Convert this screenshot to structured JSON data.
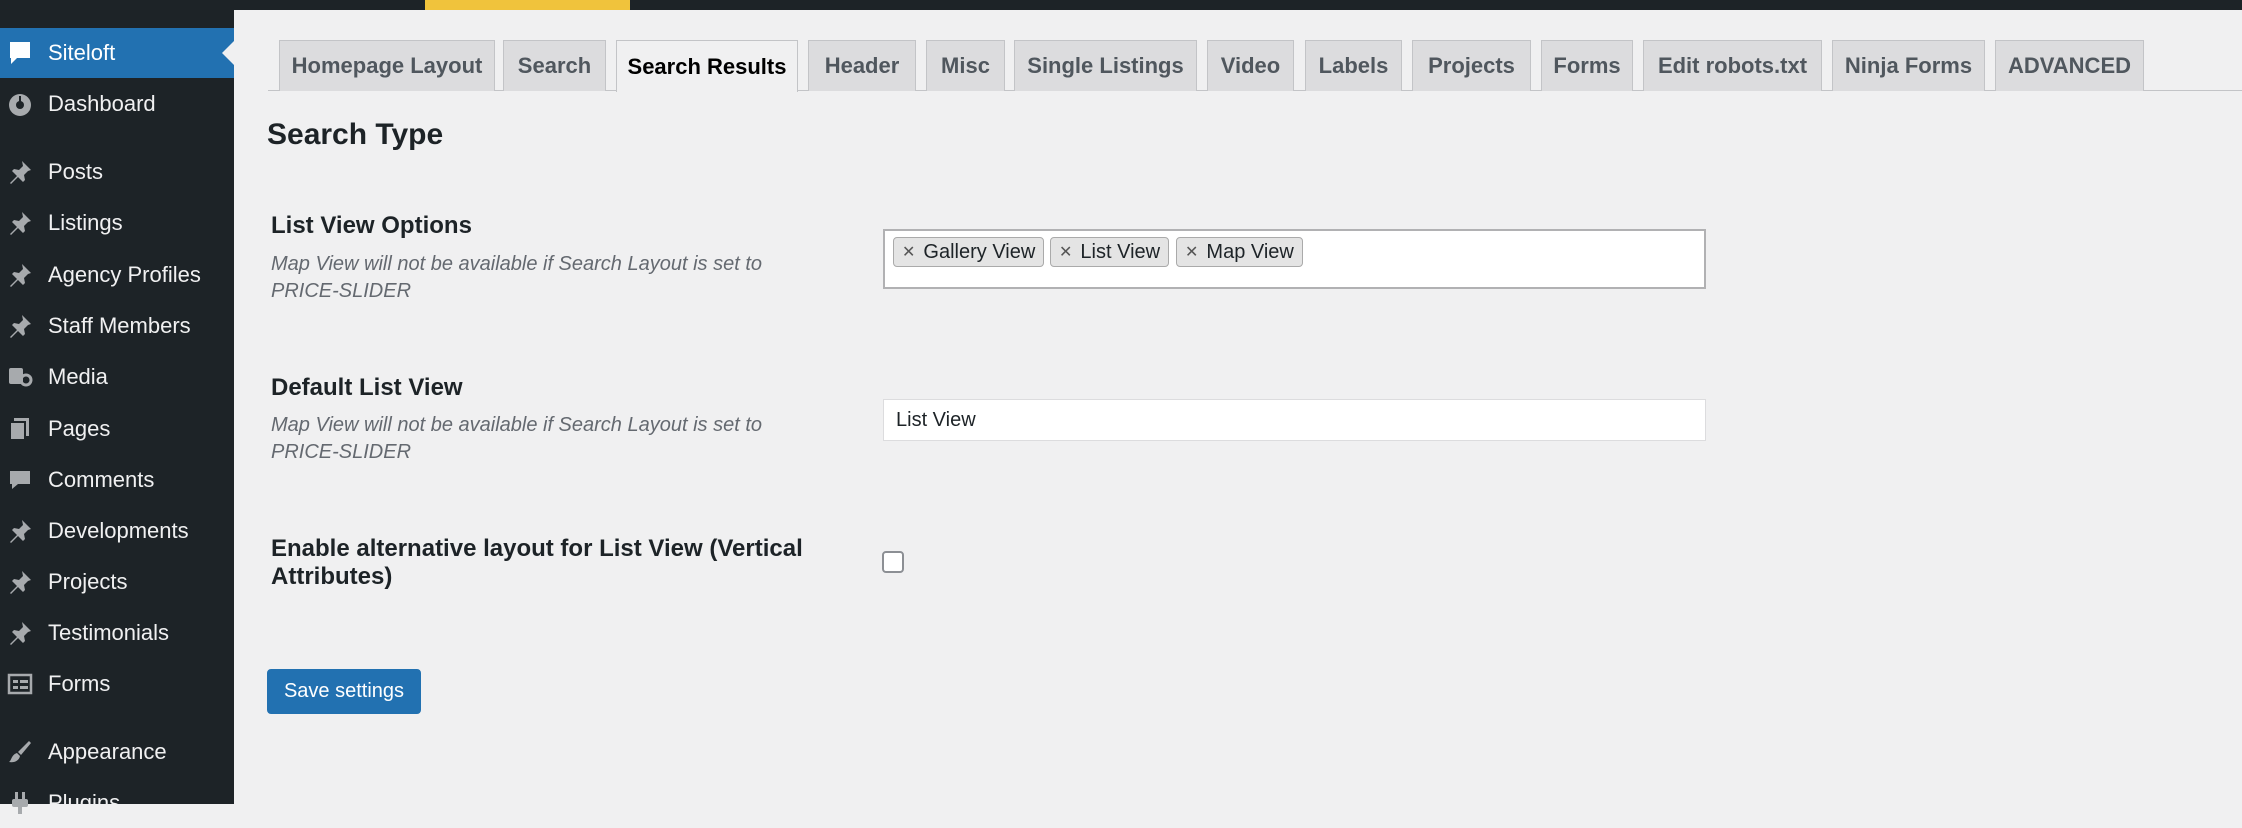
{
  "sidebar": {
    "items": [
      {
        "label": "Siteloft",
        "icon": "speech-bubble-icon",
        "active": true
      },
      {
        "label": "Dashboard",
        "icon": "dashboard-gauge-icon"
      },
      {
        "label": "Posts",
        "icon": "pushpin-icon"
      },
      {
        "label": "Listings",
        "icon": "pushpin-icon"
      },
      {
        "label": "Agency Profiles",
        "icon": "pushpin-icon"
      },
      {
        "label": "Staff Members",
        "icon": "pushpin-icon"
      },
      {
        "label": "Media",
        "icon": "media-icon"
      },
      {
        "label": "Pages",
        "icon": "pages-icon"
      },
      {
        "label": "Comments",
        "icon": "comment-icon"
      },
      {
        "label": "Developments",
        "icon": "pushpin-icon"
      },
      {
        "label": "Projects",
        "icon": "pushpin-icon"
      },
      {
        "label": "Testimonials",
        "icon": "pushpin-icon"
      },
      {
        "label": "Forms",
        "icon": "forms-icon"
      },
      {
        "label": "Appearance",
        "icon": "paintbrush-icon"
      },
      {
        "label": "Plugins",
        "icon": "plugin-icon"
      }
    ]
  },
  "tabs": [
    {
      "label": "Homepage Layout"
    },
    {
      "label": "Search"
    },
    {
      "label": "Search Results",
      "active": true
    },
    {
      "label": "Header"
    },
    {
      "label": "Misc"
    },
    {
      "label": "Single Listings"
    },
    {
      "label": "Video"
    },
    {
      "label": "Labels"
    },
    {
      "label": "Projects"
    },
    {
      "label": "Forms"
    },
    {
      "label": "Edit robots.txt"
    },
    {
      "label": "Ninja Forms"
    },
    {
      "label": "ADVANCED"
    }
  ],
  "main": {
    "section_title": "Search Type",
    "list_view_options": {
      "label": "List View Options",
      "description_line1": "Map View will not be available if Search Layout is set to",
      "description_line2": "PRICE-SLIDER",
      "selected": [
        "Gallery View",
        "List View",
        "Map View"
      ]
    },
    "default_list_view": {
      "label": "Default List View",
      "description_line1": "Map View will not be available if Search Layout is set to",
      "description_line2": "PRICE-SLIDER",
      "value": "List View"
    },
    "alternative_layout": {
      "label_line1": "Enable alternative layout for List View (Vertical",
      "label_line2": "Attributes)",
      "checked": false
    },
    "save_label": "Save settings"
  },
  "colors": {
    "sidebar_bg": "#1d2327",
    "accent_blue": "#2271b1",
    "adminbar_highlight": "#f0c33c",
    "page_bg": "#f0f0f1"
  }
}
